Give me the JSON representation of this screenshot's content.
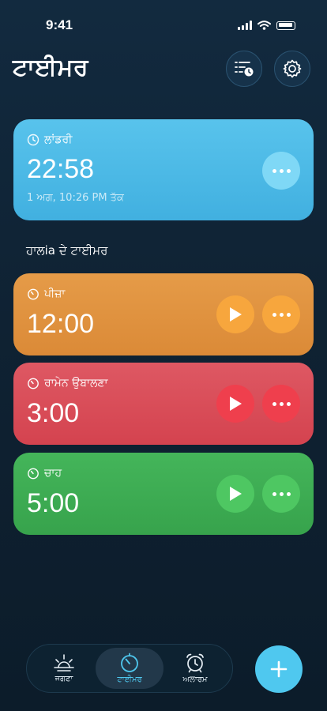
{
  "status_bar": {
    "time": "9:41"
  },
  "header": {
    "title": "ਟਾਈਮਰ",
    "list_icon": "timer-list-icon",
    "settings_icon": "settings-gear-icon"
  },
  "active_timer": {
    "label": "ਲਾਂਡਰੀ",
    "time": "22:58",
    "end_text": "1 ਅਗ, 10:26 PM ਤੱਕ",
    "color": "#4cbbe6"
  },
  "recent": {
    "title": "ਹਾਲіa ਦੇ ਟਾਈਮਰ",
    "items": [
      {
        "label": "ਪੀਜ਼ਾ",
        "time": "12:00",
        "color": "#e0913d",
        "button_color": "#f3a039"
      },
      {
        "label": "ਰਾਮੇਨ ਉਬਾਲਣਾ",
        "time": "3:00",
        "color": "#d84a55",
        "button_color": "#ef3f4d"
      },
      {
        "label": "ਚਾਹ",
        "time": "5:00",
        "color": "#3dab52",
        "button_color": "#49c660"
      }
    ]
  },
  "tab_bar": {
    "tabs": [
      {
        "label": "ਜਗਣਾ",
        "icon": "sunrise-icon"
      },
      {
        "label": "ਟਾਈਮਰ",
        "icon": "timer-icon",
        "selected": true
      },
      {
        "label": "ਅਲਾਰਮ",
        "icon": "alarm-clock-icon"
      }
    ]
  },
  "fab": {
    "icon": "plus-icon"
  }
}
